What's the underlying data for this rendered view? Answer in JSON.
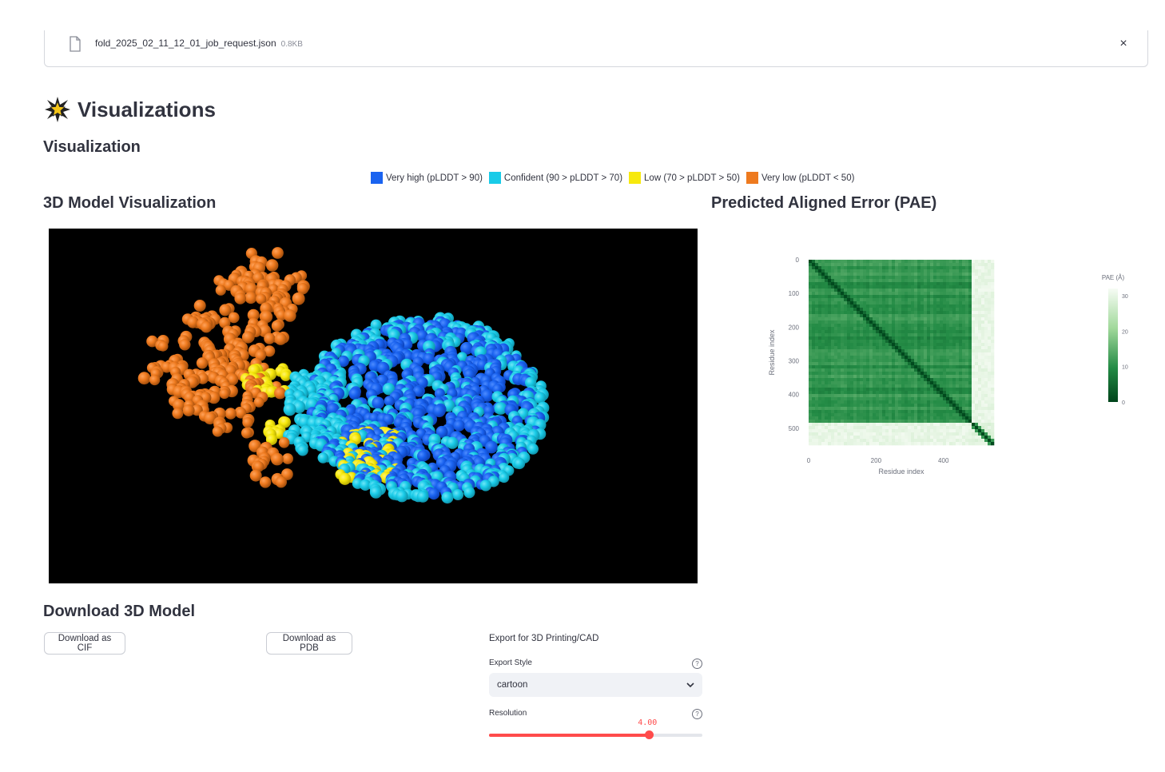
{
  "file": {
    "name": "fold_2025_02_11_12_01_job_request.json",
    "size": "0.8KB",
    "close_symbol": "×"
  },
  "page": {
    "title": "Visualizations",
    "title_icon": "sparkle-star-icon"
  },
  "visualization": {
    "heading": "Visualization",
    "legend": [
      {
        "label": "Very high (pLDDT > 90)",
        "color": "#1a63f0"
      },
      {
        "label": "Confident (90 > pLDDT > 70)",
        "color": "#19cbe8"
      },
      {
        "label": "Low (70 > pLDDT > 50)",
        "color": "#f7e90d"
      },
      {
        "label": "Very low (pLDDT < 50)",
        "color": "#ee7a1f"
      }
    ]
  },
  "model_view": {
    "heading": "3D Model Visualization",
    "background": "#000000"
  },
  "pae": {
    "heading": "Predicted Aligned Error (PAE)",
    "chart_data": {
      "type": "heatmap",
      "xlabel": "Residue index",
      "ylabel": "Residue index",
      "xticks": [
        "0",
        "200",
        "400"
      ],
      "yticks": [
        "0",
        "100",
        "200",
        "300",
        "400",
        "500"
      ],
      "xlim": [
        0,
        550
      ],
      "ylim": [
        0,
        550
      ],
      "colorbar": {
        "title": "PAE (Å)",
        "ticks": [
          "30",
          "20",
          "10",
          "0"
        ],
        "range": [
          0,
          32
        ],
        "colors": [
          "#00441b",
          "#f7fcf5"
        ]
      },
      "structured_region_end": 480
    }
  },
  "download": {
    "heading": "Download 3D Model",
    "cif_label": "Download as CIF",
    "pdb_label": "Download as PDB",
    "export_heading": "Export for 3D Printing/CAD",
    "style_label": "Export Style",
    "style_value": "cartoon",
    "resolution_label": "Resolution",
    "resolution_value": "4.00",
    "resolution_fraction": 0.75,
    "help_symbol": "?"
  }
}
